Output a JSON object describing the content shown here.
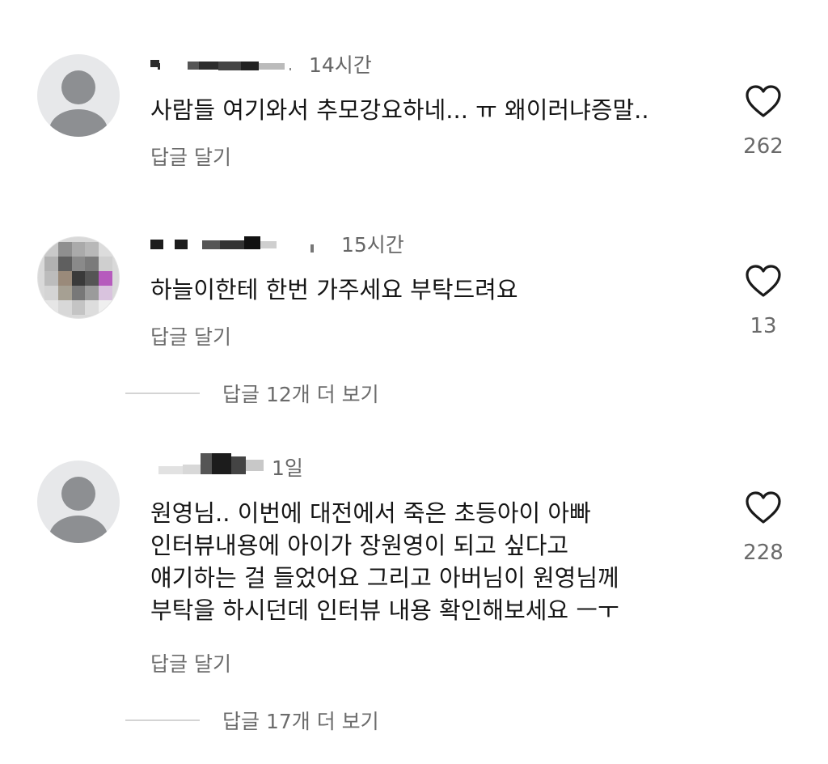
{
  "comments": [
    {
      "timestamp": "14시간",
      "text": "사람들 여기와서 추모강요하네... ㅠ 왜이러냐증말..",
      "reply_label": "답글 달기",
      "like_count": "262",
      "avatar": "default-avatar-icon"
    },
    {
      "timestamp": "15시간",
      "text": "하늘이한테 한번 가주세요 부탁드려요",
      "reply_label": "답글 달기",
      "like_count": "13",
      "avatar": "pixelated-avatar"
    },
    {
      "timestamp": "1일",
      "text": "원영님.. 이번에 대전에서 죽은 초등아이 아빠\n인터뷰내용에 아이가 장원영이 되고 싶다고\n얘기하는 걸 들었어요 그리고 아버님이 원영님께\n부탁을 하시던데 인터뷰 내용 확인해보세요 ㅡㅜ",
      "reply_label": "답글 달기",
      "like_count": "228",
      "avatar": "default-avatar-icon"
    }
  ],
  "more_replies": [
    {
      "label": "답글 12개 더 보기"
    },
    {
      "label": "답글 17개 더 보기"
    }
  ],
  "icons": {
    "like": "heart-outline-icon"
  },
  "colors": {
    "text": "#151515",
    "muted": "#6b6b6b",
    "avatar_bg": "#e7e8ea",
    "avatar_fg": "#8d8f92"
  }
}
